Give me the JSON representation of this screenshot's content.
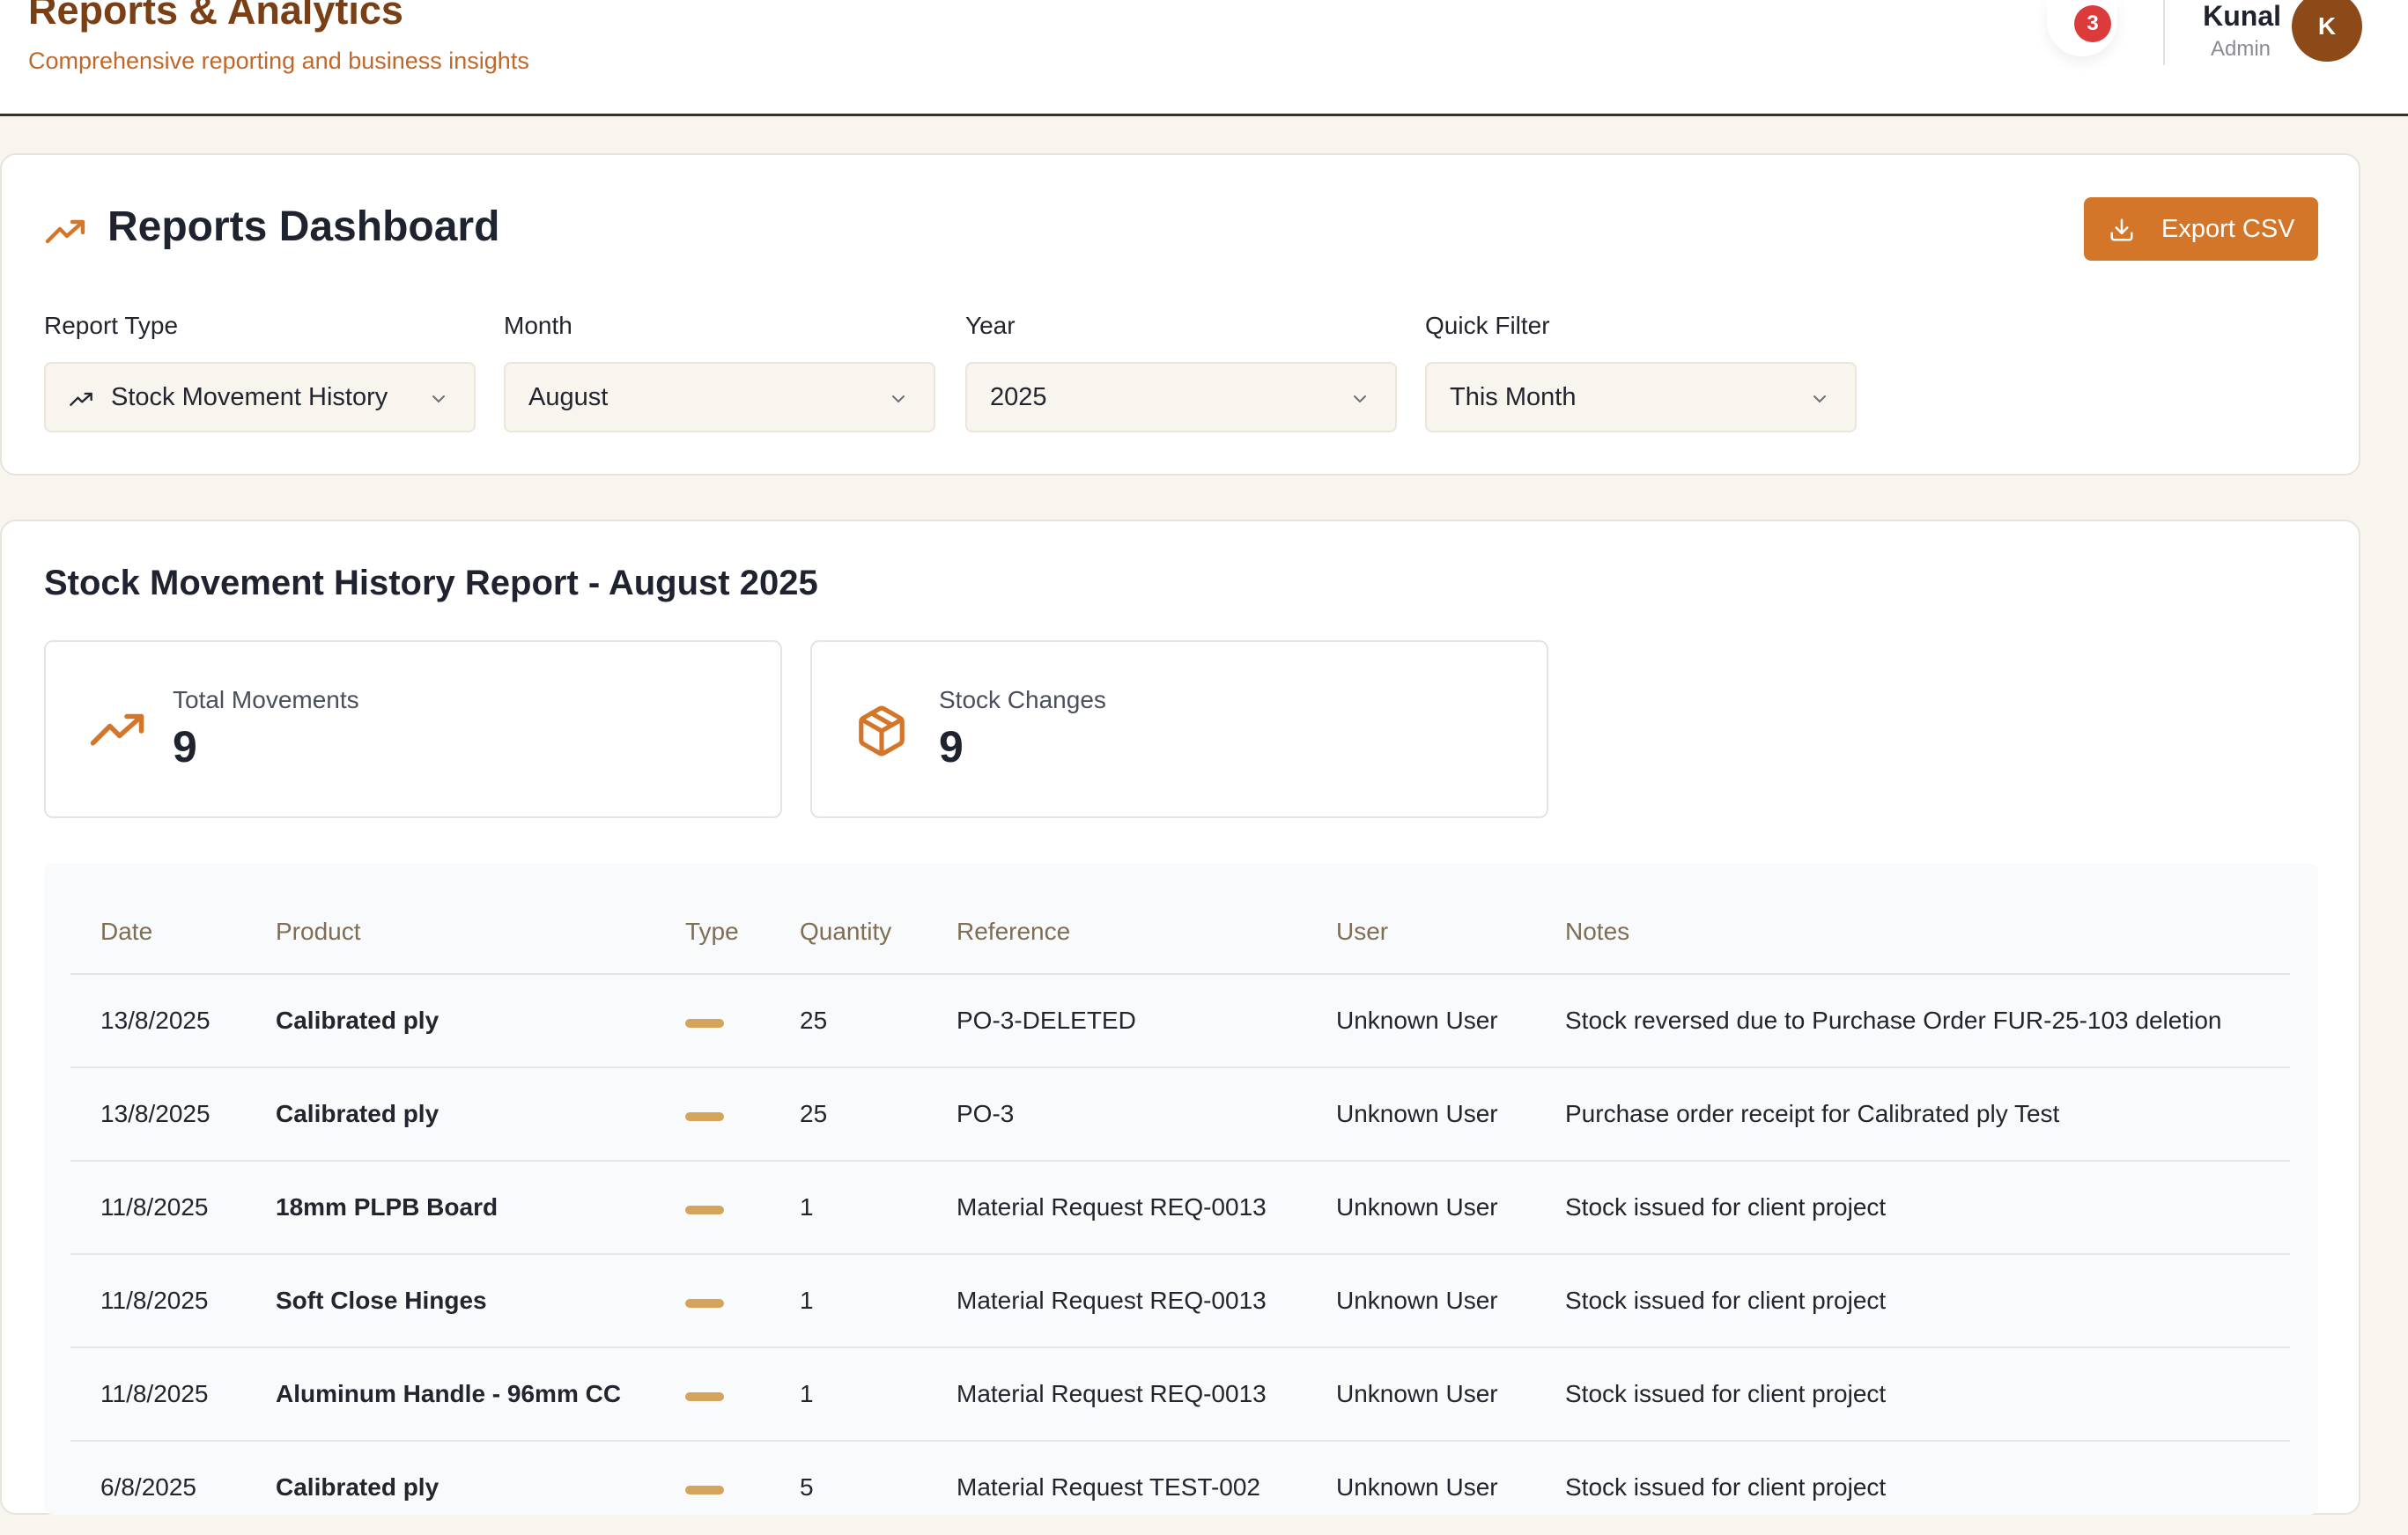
{
  "header": {
    "title": "Reports & Analytics",
    "subtitle": "Comprehensive reporting and business insights",
    "notification_count": "3",
    "user_name": "Kunal",
    "user_role": "Admin",
    "avatar_initial": "K"
  },
  "dashboard": {
    "title": "Reports Dashboard",
    "export_label": "Export CSV",
    "filters": [
      {
        "label": "Report Type",
        "value": "Stock Movement History"
      },
      {
        "label": "Month",
        "value": "August"
      },
      {
        "label": "Year",
        "value": "2025"
      },
      {
        "label": "Quick Filter",
        "value": "This Month"
      }
    ]
  },
  "report": {
    "title": "Stock Movement History Report - August 2025",
    "stats": [
      {
        "label": "Total Movements",
        "value": "9",
        "icon": "trending-up-icon"
      },
      {
        "label": "Stock Changes",
        "value": "9",
        "icon": "package-icon"
      }
    ],
    "columns": [
      "Date",
      "Product",
      "Type",
      "Quantity",
      "Reference",
      "User",
      "Notes"
    ],
    "rows": [
      {
        "date": "13/8/2025",
        "product": "Calibrated ply",
        "quantity": "25",
        "reference": "PO-3-DELETED",
        "user": "Unknown User",
        "notes": "Stock reversed due to Purchase Order FUR-25-103 deletion"
      },
      {
        "date": "13/8/2025",
        "product": "Calibrated ply",
        "quantity": "25",
        "reference": "PO-3",
        "user": "Unknown User",
        "notes": "Purchase order receipt for Calibrated ply Test"
      },
      {
        "date": "11/8/2025",
        "product": "18mm PLPB Board",
        "quantity": "1",
        "reference": "Material Request REQ-0013",
        "user": "Unknown User",
        "notes": "Stock issued for client project"
      },
      {
        "date": "11/8/2025",
        "product": "Soft Close Hinges",
        "quantity": "1",
        "reference": "Material Request REQ-0013",
        "user": "Unknown User",
        "notes": "Stock issued for client project"
      },
      {
        "date": "11/8/2025",
        "product": "Aluminum Handle - 96mm CC",
        "quantity": "1",
        "reference": "Material Request REQ-0013",
        "user": "Unknown User",
        "notes": "Stock issued for client project"
      },
      {
        "date": "6/8/2025",
        "product": "Calibrated ply",
        "quantity": "5",
        "reference": "Material Request TEST-002",
        "user": "Unknown User",
        "notes": "Stock issued for client project"
      }
    ]
  },
  "colors": {
    "accent": "#d4762a",
    "brand_dark": "#7a3f14",
    "badge_red": "#dc3b3b",
    "type_indicator": "#d4a35c"
  }
}
